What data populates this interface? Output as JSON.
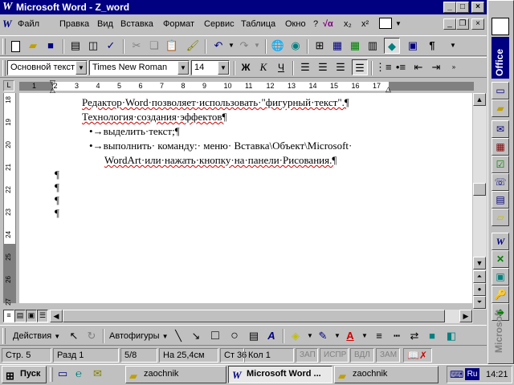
{
  "window": {
    "title": "Microsoft Word - Z_word",
    "controls": {
      "minimize": "_",
      "maximize": "□",
      "close": "×"
    }
  },
  "menu": {
    "items": [
      "Файл",
      "Правка",
      "Вид",
      "Вставка",
      "Формат",
      "Сервис",
      "Таблица",
      "Окно",
      "?"
    ],
    "extra": [
      "√α",
      "x₂",
      "x²"
    ]
  },
  "formatting": {
    "style": "Основной текст",
    "font": "Times New Roman",
    "size": "14",
    "bold": "Ж",
    "italic": "К",
    "underline": "Ч"
  },
  "ruler": {
    "numbers": [
      "1",
      "2",
      "3",
      "4",
      "5",
      "6",
      "7",
      "8",
      "9",
      "10",
      "11",
      "12",
      "13",
      "14",
      "15",
      "16",
      "17"
    ],
    "vertical_numbers": [
      "18",
      "19",
      "20",
      "21",
      "22",
      "23",
      "24",
      "25",
      "26",
      "27"
    ]
  },
  "document": {
    "lines": [
      "Редактор·Word·позволяет·использовать·\"фигурный·текст\".¶",
      "Технология·создания·эффектов¶"
    ],
    "bullets": [
      "→выделить·текст;¶",
      "→выполнить·  команду:·  меню·  Вставка\\Объект\\Microsoft·"
    ],
    "bullet_continuation": "WordArt·или·нажать·кнопку·на·панели·Рисования.¶",
    "empty_marks": [
      "¶",
      "¶",
      "¶",
      "¶"
    ]
  },
  "drawing": {
    "actions": "Действия",
    "autoshapes": "Автофигуры"
  },
  "statusbar": {
    "page": "Стр. 5",
    "section": "Разд 1",
    "pages": "5/8",
    "at": "На 25,4см",
    "line": "Ст 36",
    "col": "Кол 1",
    "rec": "ЗАП",
    "trk": "ИСПР",
    "ext": "ВДЛ",
    "ovr": "ЗАМ"
  },
  "office_bar": {
    "label": "Office",
    "label2": "Microsoft"
  },
  "taskbar": {
    "start": "Пуск",
    "buttons": [
      "zaochnik",
      "Microsoft Word ...",
      "zaochnik"
    ],
    "lang": "Ru",
    "clock": "14:21"
  }
}
